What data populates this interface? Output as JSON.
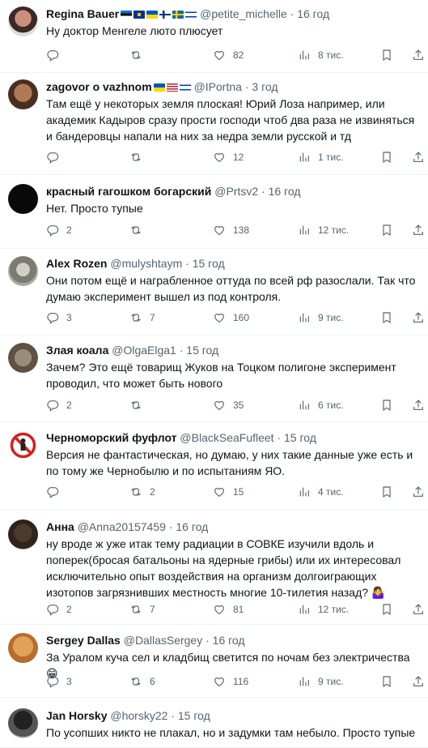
{
  "tweets": [
    {
      "name": "Regina Bauer",
      "flags": [
        "estonia",
        "eu",
        "ukraine",
        "finland",
        "sweden",
        "israel"
      ],
      "handle": "@petite_michelle",
      "time": "16 год",
      "text": "Ну доктор Менгеле люто плюсует",
      "replies": "",
      "retweets": "",
      "likes": "82",
      "views": "8 тис."
    },
    {
      "name": "zagovor o vazhnom",
      "flags": [
        "ukraine",
        "usa",
        "israel"
      ],
      "handle": "@IPortna",
      "time": "3 год",
      "text": "Там ещё у некоторых земля плоская! Юрий Лоза например, или академик Кадыров сразу прости господи чтоб два раза не извиняться и бандеровцы напали на них за недра земли русской и тд",
      "replies": "",
      "retweets": "",
      "likes": "12",
      "views": "1 тис."
    },
    {
      "name": "красный гагошком богарский",
      "flags": [],
      "handle": "@Prtsv2",
      "time": "16 год",
      "text": "Нет. Просто тупые",
      "replies": "2",
      "retweets": "",
      "likes": "138",
      "views": "12 тис."
    },
    {
      "name": "Alex Rozen",
      "flags": [],
      "handle": "@mulyshtaym",
      "time": "15 год",
      "text": "Они потом ещё и награбленное оттуда по всей рф разослали. Так что думаю эксперимент вышел из под контроля.",
      "replies": "3",
      "retweets": "7",
      "likes": "160",
      "views": "9 тис."
    },
    {
      "name": "Злая коала",
      "flags": [],
      "handle": "@OlgaElga1",
      "time": "15 год",
      "text": "Зачем? Это ещё товарищ Жуков на Тоцком полигоне эксперимент проводил, что может быть нового",
      "replies": "2",
      "retweets": "",
      "likes": "35",
      "views": "6 тис."
    },
    {
      "name": "Черноморский фуфлот",
      "flags": [],
      "handle": "@BlackSeaFufleet",
      "time": "15 год",
      "text": "Версия не фантастическая,  но думаю, у них такие данные уже есть и по тому же Чернобылю и по испытаниям ЯО.",
      "replies": "",
      "retweets": "2",
      "likes": "15",
      "views": "4 тис."
    },
    {
      "name": "Анна",
      "flags": [],
      "handle": "@Anna20157459",
      "time": "16 год",
      "text": "ну вроде ж уже итак тему радиации в СОВКЕ изучили вдоль и поперек(бросая батальоны на ядерные  грибы) или их интересовал исключительно опыт воздействия на организм долгоиграющих изотопов загрязнивших местность многие 10-тилетия назад?",
      "emoji": "🤷‍♀️",
      "replies": "2",
      "retweets": "7",
      "likes": "81",
      "views": "12 тис."
    },
    {
      "name": "Sergey Dallas",
      "flags": [],
      "handle": "@DallasSergey",
      "time": "16 год",
      "text": "За Уралом куча сел и кладбищ светится по ночам без электричества",
      "emoji": "😁",
      "replies": "3",
      "retweets": "6",
      "likes": "116",
      "views": "9 тис."
    },
    {
      "name": "Jan Horsky",
      "flags": [],
      "handle": "@horsky22",
      "time": "15 год",
      "text": "По усопших никто не плакал, но и задумки там небыло. Просто тупые",
      "replies": "",
      "retweets": "",
      "likes": "",
      "views": ""
    }
  ]
}
